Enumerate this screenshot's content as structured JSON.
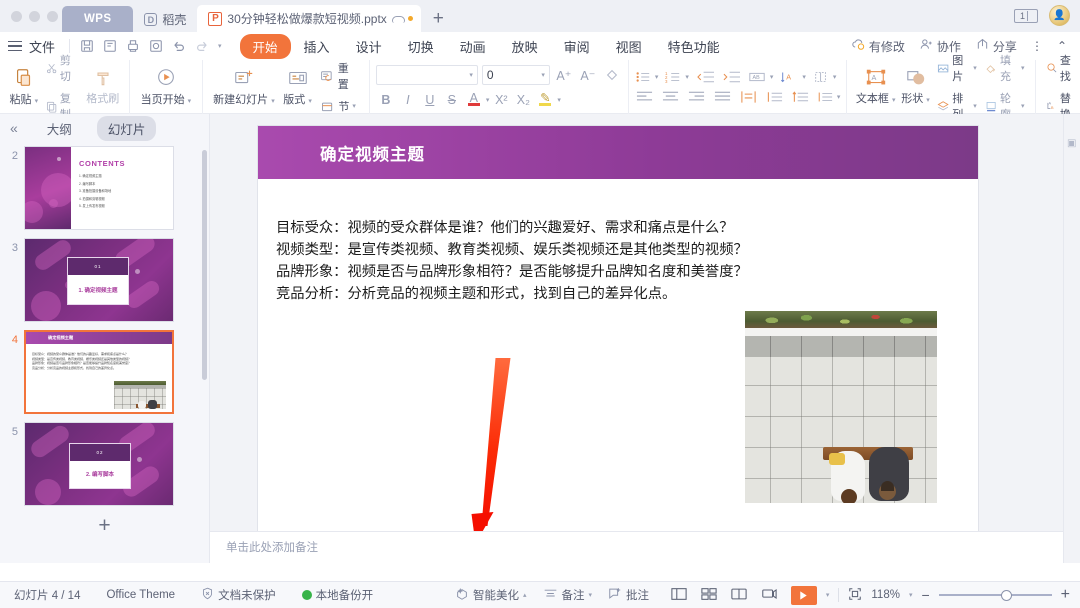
{
  "titlebar": {
    "wps_tab": "WPS",
    "daoke_tab": "稻壳",
    "doc_tab": "30分钟轻松做爆款短视频.pptx",
    "new_tab": "+",
    "restore_label": "1"
  },
  "menubar": {
    "file": "文件",
    "items": [
      {
        "label": "开始",
        "selected": true
      },
      {
        "label": "插入",
        "selected": false
      },
      {
        "label": "设计",
        "selected": false
      },
      {
        "label": "切换",
        "selected": false
      },
      {
        "label": "动画",
        "selected": false
      },
      {
        "label": "放映",
        "selected": false
      },
      {
        "label": "审阅",
        "selected": false
      },
      {
        "label": "视图",
        "selected": false
      },
      {
        "label": "特色功能",
        "selected": false
      }
    ],
    "right": [
      {
        "label": "有修改",
        "icon": "cloud-modified-icon"
      },
      {
        "label": "协作",
        "icon": "collaborate-icon"
      },
      {
        "label": "分享",
        "icon": "share-icon"
      }
    ],
    "more": "⋮",
    "collapse": "⌃"
  },
  "ribbon": {
    "clipboard": {
      "paste": "粘贴",
      "cut": "剪切",
      "copy": "复制",
      "format_painter": "格式刷"
    },
    "present": {
      "from_current": "当页开始"
    },
    "slides": {
      "new_slide": "新建幻灯片",
      "layout": "版式",
      "reset": "重置",
      "section": "节"
    },
    "font": {
      "font_name": "",
      "font_size": "0",
      "grow": "A⁺",
      "shrink": "A⁻",
      "clear_format": "清除格式",
      "bold": "B",
      "italic": "I",
      "underline": "U",
      "strike": "S",
      "font_color": "A",
      "superscript": "X²",
      "subscript": "X₂",
      "highlight": "✎"
    },
    "paragraph": {
      "bullets": "项目符号",
      "numbering": "编号",
      "decrease_indent": "减少缩进",
      "increase_indent": "增加缩进",
      "text_direction": "文字方向",
      "align_text": "对齐文本",
      "columns": "分栏",
      "align_left": "左对齐",
      "align_center": "居中",
      "align_right": "右对齐",
      "justify": "两端对齐",
      "distribute": "分散对齐",
      "line_spacing": "行距"
    },
    "drawing": {
      "textbox": "文本框",
      "shape": "形状",
      "picture": "图片",
      "arrange": "排列",
      "fill": "填充",
      "outline": "轮廓"
    },
    "editing": {
      "find": "查找",
      "replace": "替换"
    }
  },
  "slidepanel": {
    "collapse_icon": "«",
    "tab_outline": "大纲",
    "tab_slides": "幻灯片",
    "add_slide": "+",
    "thumbs": [
      {
        "num": "2",
        "type": "contents",
        "title": "CONTENTS",
        "items": [
          "1. 确定视频主题",
          "2. 编写脚本",
          "3. 准备拍摄设备和场地",
          "4. 拍摄和剪辑视频",
          "5. 发上传发布视频"
        ]
      },
      {
        "num": "3",
        "type": "section",
        "number": "01",
        "title": "1. 确定视频主题"
      },
      {
        "num": "4",
        "type": "content",
        "title": "确定视频主题",
        "selected": true
      },
      {
        "num": "5",
        "type": "section",
        "number": "02",
        "title": "2. 编写脚本"
      }
    ]
  },
  "slide": {
    "title": "确定视频主题",
    "lines": [
      "目标受众：视频的受众群体是谁？他们的兴趣爱好、需求和痛点是什么？",
      "视频类型：是宣传类视频、教育类视频、娱乐类视频还是其他类型的视频？",
      "品牌形象：视频是否与品牌形象相符？是否能够提升品牌知名度和美誉度？",
      "竞品分析：分析竞品的视频主题和形式，找到自己的差异化点。"
    ],
    "image_alt": "俯拍两人坐长椅照片"
  },
  "notes": {
    "placeholder": "单击此处添加备注"
  },
  "statusbar": {
    "slide_counter": "幻灯片 4 / 14",
    "theme": "Office Theme",
    "protection": "文档未保护",
    "backup": "本地备份开",
    "beautify": "智能美化",
    "notes_btn": "备注",
    "comment_btn": "批注",
    "view_normal": "普通视图",
    "view_sorter": "幻灯片浏览",
    "view_reading": "阅读视图",
    "view_present": "演讲者视图",
    "play": "放映",
    "fit": "适应窗口",
    "zoom": "118%",
    "zoom_out": "−",
    "zoom_in": "+"
  },
  "colors": {
    "accent": "#f2743b",
    "title_purple": "#8e3b97",
    "wps_tab_bg": "#a9b0c9",
    "arrow_red": "#fa2500",
    "green": "#37b349"
  }
}
